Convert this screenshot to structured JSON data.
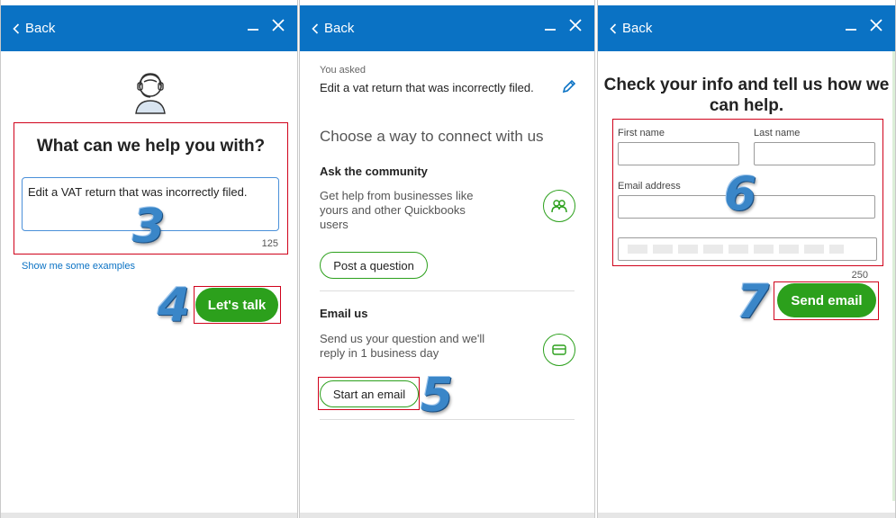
{
  "panels": {
    "p1": {
      "back_label": "Back",
      "heading": "What can we help you with?",
      "question_value": "Edit a VAT return that was incorrectly filed.",
      "char_counter": "125",
      "examples_link": "Show me some examples",
      "talk_button": "Let's talk"
    },
    "p2": {
      "back_label": "Back",
      "asked_label": "You asked",
      "asked_text": "Edit a vat return that was incorrectly filed.",
      "choose_heading": "Choose a way to connect with us",
      "community_title": "Ask the community",
      "community_desc": "Get help from businesses like yours and other Quickbooks users",
      "post_button": "Post a question",
      "email_title": "Email us",
      "email_desc": "Send us your question and we'll reply in 1 business day",
      "email_button": "Start an email"
    },
    "p3": {
      "back_label": "Back",
      "heading": "Check your info and tell us how we can help.",
      "first_name_label": "First name",
      "last_name_label": "Last name",
      "email_label": "Email address",
      "char_counter": "250",
      "send_button": "Send email"
    }
  },
  "annotations": {
    "step3": "3",
    "step4": "4",
    "step5": "5",
    "step6": "6",
    "step7": "7"
  },
  "colors": {
    "header_blue": "#0a72c4",
    "action_green": "#2ca01c",
    "highlight_red": "#d0021b",
    "step_number_blue": "#3a86c8"
  },
  "icons": {
    "agent": "headset-agent-icon",
    "pencil": "pencil-edit-icon",
    "community": "people-group-icon",
    "email": "envelope-icon",
    "minimize": "minimize-icon",
    "close": "close-icon",
    "back": "chevron-left-icon"
  }
}
